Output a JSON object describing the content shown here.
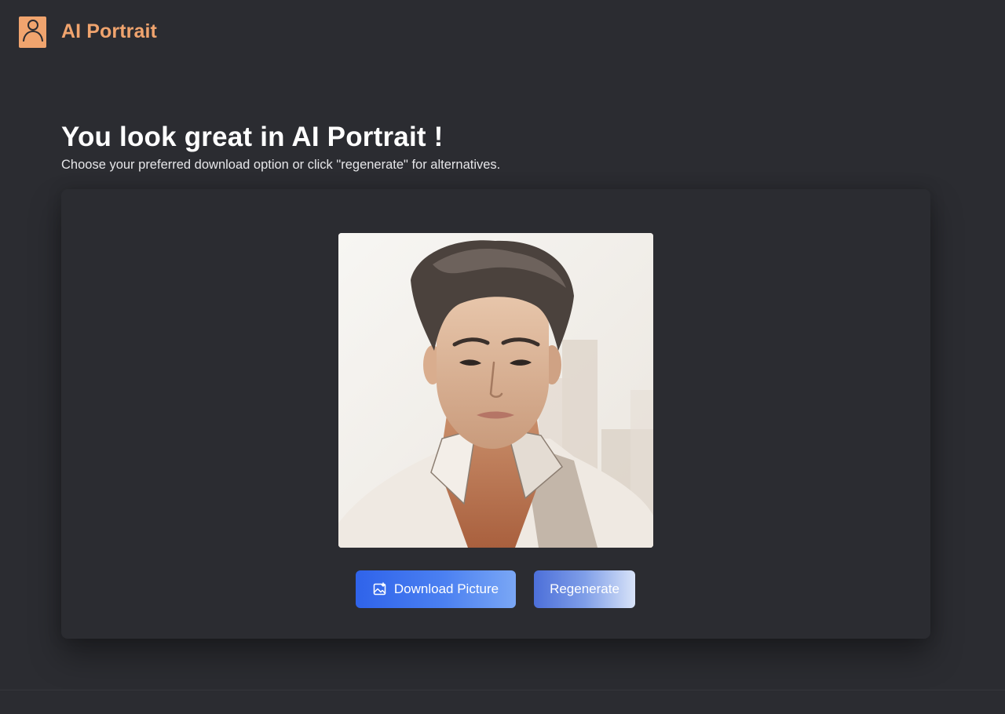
{
  "header": {
    "logo_icon": "user-icon",
    "brand": "AI Portrait",
    "brand_color": "#f0a46e"
  },
  "main": {
    "title": "You look great in AI Portrait !",
    "subtitle": "Choose your preferred download option or click \"regenerate\" for alternatives."
  },
  "result": {
    "image_alt": "Generated watercolor portrait",
    "download_label": "Download Picture",
    "download_icon": "image-download-icon",
    "regenerate_label": "Regenerate",
    "accent_color": "#2f63ea"
  }
}
